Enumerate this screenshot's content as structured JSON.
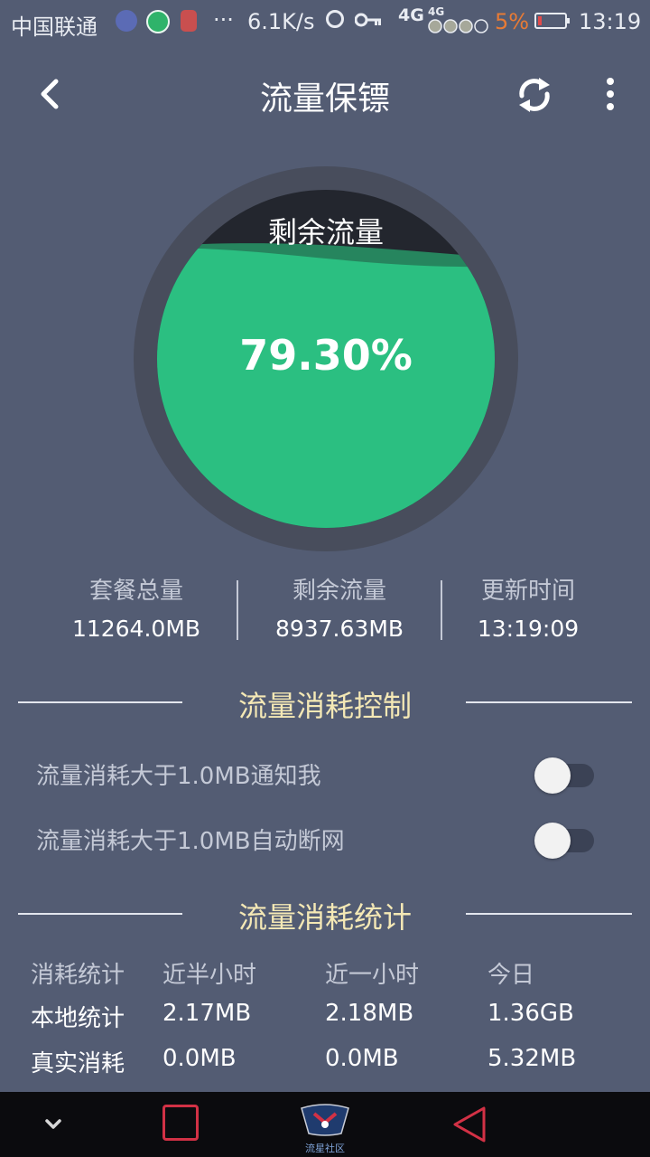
{
  "status_bar": {
    "carrier": "中国联通",
    "more": "···",
    "net_speed": "6.1K/s",
    "net_type_1": "4G",
    "net_type_2": "4G",
    "battery_percent": "5%",
    "time": "13:19",
    "icons": [
      "app-icon",
      "app-icon",
      "app-icon",
      "alarm-icon",
      "key-icon",
      "signal-icon",
      "battery-icon"
    ]
  },
  "header": {
    "title": "流量保镖",
    "icons": {
      "back": "chevron-left-icon",
      "refresh": "refresh-icon",
      "more": "more-vertical-icon"
    }
  },
  "gauge": {
    "label": "剩余流量",
    "value_text": "79.30%",
    "fill_fraction": 0.793,
    "colors": {
      "fill": "#2bbf81",
      "wave": "#26855e",
      "empty": "#23262e",
      "ring": "#484d5c"
    }
  },
  "summary": [
    {
      "label": "套餐总量",
      "value": "11264.0MB"
    },
    {
      "label": "剩余流量",
      "value": "8937.63MB"
    },
    {
      "label": "更新时间",
      "value": "13:19:09"
    }
  ],
  "control_section": {
    "title": "流量消耗控制",
    "settings": [
      {
        "label": "流量消耗大于1.0MB通知我",
        "enabled": false
      },
      {
        "label": "流量消耗大于1.0MB自动断网",
        "enabled": false
      }
    ]
  },
  "stats_section": {
    "title": "流量消耗统计",
    "headers": [
      "消耗统计",
      "近半小时",
      "近一小时",
      "今日"
    ],
    "rows": [
      [
        "本地统计",
        "2.17MB",
        "2.18MB",
        "1.36GB"
      ],
      [
        "真实消耗",
        "0.0MB",
        "0.0MB",
        "5.32MB"
      ]
    ]
  },
  "nav_bar": {
    "home_label": "流星社区",
    "icons": [
      "chevron-down-icon",
      "recent-apps-icon",
      "home-logo-icon",
      "back-triangle-icon"
    ]
  },
  "colors": {
    "background": "#535c73",
    "section_title": "#f4e8b5",
    "muted_text": "#c4c9d6",
    "battery_low": "#e87b35"
  }
}
